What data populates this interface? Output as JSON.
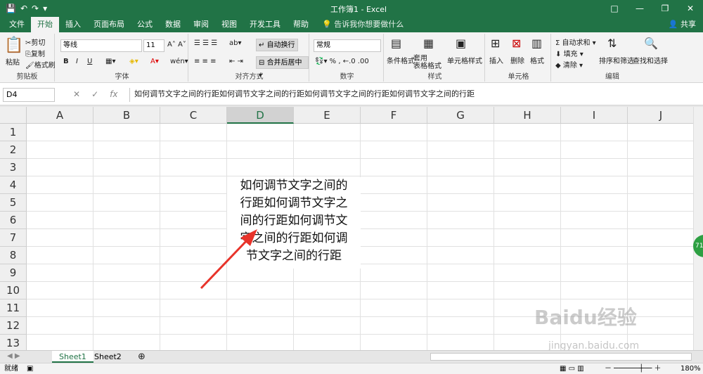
{
  "window": {
    "title": "工作簿1  -  Excel",
    "controls": [
      "□",
      "—",
      "❐",
      "✕"
    ]
  },
  "quick_access": [
    "save-icon",
    "undo-icon",
    "redo-icon",
    "customize-icon"
  ],
  "tabs": [
    "文件",
    "开始",
    "插入",
    "页面布局",
    "公式",
    "数据",
    "审阅",
    "视图",
    "开发工具",
    "帮助"
  ],
  "active_tab": "开始",
  "tell_me": "告诉我你想要做什么",
  "share": "共享",
  "ribbon": {
    "clipboard": {
      "paste": "粘贴",
      "cut": "剪切",
      "copy": "复制",
      "format_painter": "格式刷",
      "label": "剪贴板"
    },
    "font": {
      "name": "等线",
      "size": "11",
      "label": "字体",
      "bold": "B",
      "italic": "I",
      "underline": "U"
    },
    "alignment": {
      "wrap": "自动换行",
      "merge": "合并后居中",
      "label": "对齐方式"
    },
    "number": {
      "format": "常规",
      "label": "数字"
    },
    "styles": {
      "conditional": "条件格式",
      "table": "套用\n表格格式",
      "cell_styles": "单元格样式",
      "label": "样式"
    },
    "cells": {
      "insert": "插入",
      "delete": "删除",
      "format": "格式",
      "label": "单元格"
    },
    "editing": {
      "autosum": "自动求和",
      "fill": "填充",
      "clear": "清除",
      "sort": "排序和筛选",
      "find": "查找和选择",
      "label": "编辑"
    }
  },
  "formula_bar": {
    "name_box": "D4",
    "fx": "fx",
    "content": "如何调节文字之间的行距如何调节文字之间的行距如何调节文字之间的行距如何调节文字之间的行距"
  },
  "columns": [
    "A",
    "B",
    "C",
    "D",
    "E",
    "F",
    "G",
    "H",
    "I",
    "J"
  ],
  "rows": [
    "1",
    "2",
    "3",
    "4",
    "5",
    "6",
    "7",
    "8",
    "9",
    "10",
    "11",
    "12",
    "13"
  ],
  "selected_column": "D",
  "cell_lines": [
    "如何调节文字之间的",
    "行距如何调节文字之",
    "间的行距如何调节文",
    "字之间的行距如何调",
    "节文字之间的行距"
  ],
  "sheets": [
    "Sheet1",
    "Sheet2"
  ],
  "active_sheet": "Sheet1",
  "status": {
    "ready": "就绪",
    "zoom": "180%"
  },
  "watermark": {
    "main": "Baidu经验",
    "sub": "jingyan.baidu.com"
  },
  "colors": {
    "excel_green": "#217346",
    "arrow": "#e8332a"
  }
}
